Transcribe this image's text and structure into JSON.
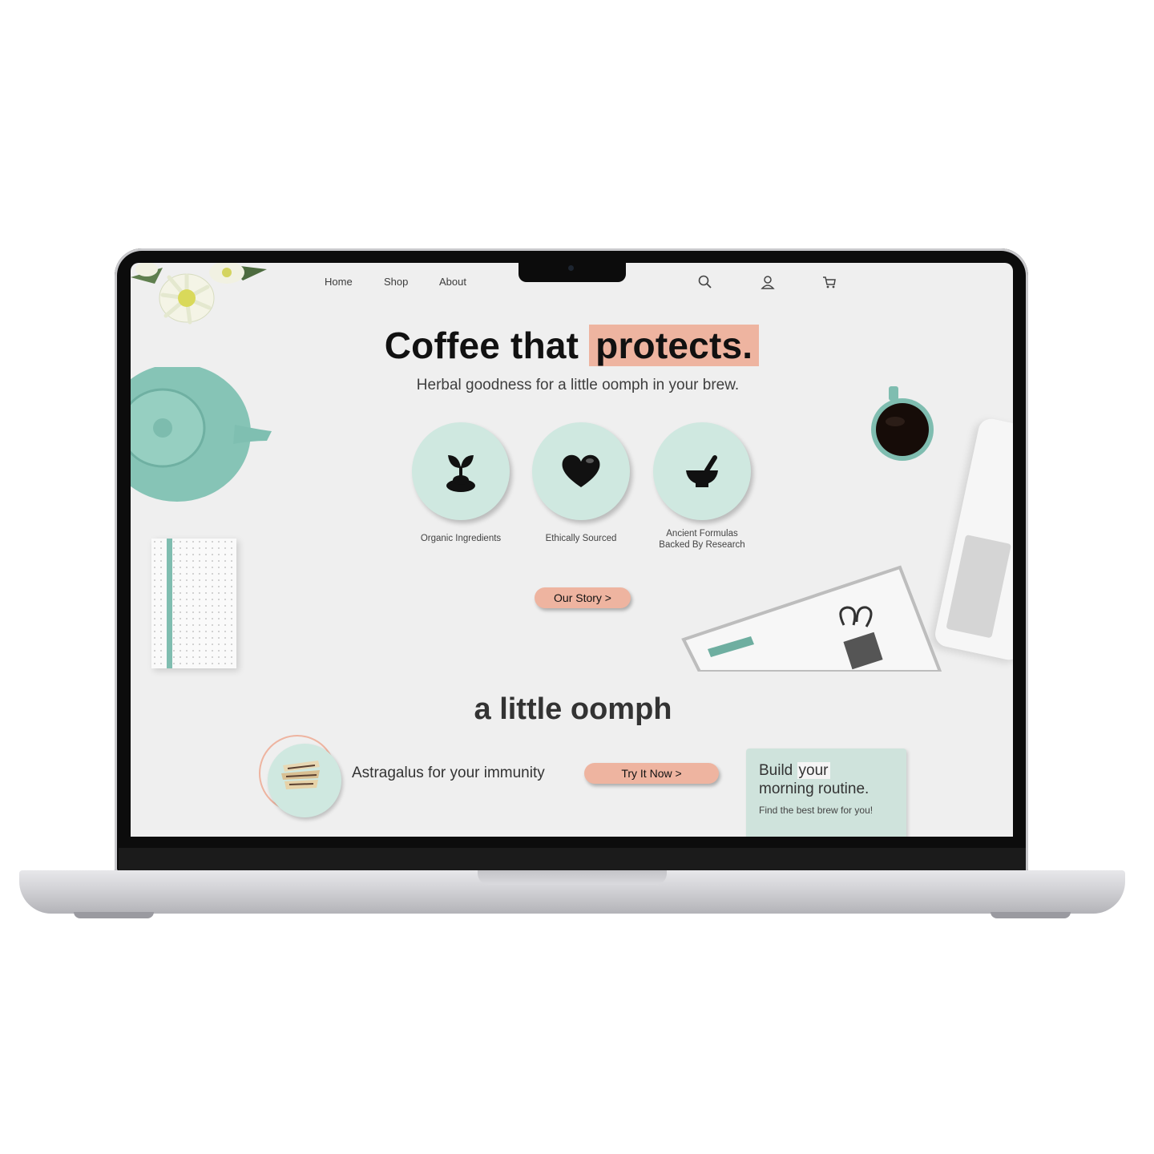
{
  "nav": {
    "links": [
      "Home",
      "Shop",
      "About"
    ],
    "icons": [
      "search-icon",
      "user-icon",
      "cart-icon"
    ]
  },
  "hero": {
    "title_main": "Coffee that",
    "title_highlight": "protects.",
    "subtitle": "Herbal goodness for a little oomph in your brew.",
    "features": [
      {
        "label": "Organic Ingredients",
        "icon": "sprout-icon"
      },
      {
        "label": "Ethically Sourced",
        "icon": "heart-icon"
      },
      {
        "label_line1": "Ancient Formulas",
        "label_line2": "Backed By Research",
        "icon": "mortar-pestle-icon"
      }
    ],
    "cta_label": "Our Story >"
  },
  "section": {
    "title": "a little oomph",
    "product_text": "Astragalus for your immunity",
    "product_cta": "Try It Now >"
  },
  "card": {
    "title_line1_a": "Build",
    "title_line1_b": "your",
    "title_line2": "morning routine.",
    "subtitle": "Find the best brew for you!"
  },
  "colors": {
    "accent_peach": "#eeb4a0",
    "mint": "#cfe8e0",
    "teal": "#7fbdb0",
    "screen_bg": "#efefef"
  }
}
